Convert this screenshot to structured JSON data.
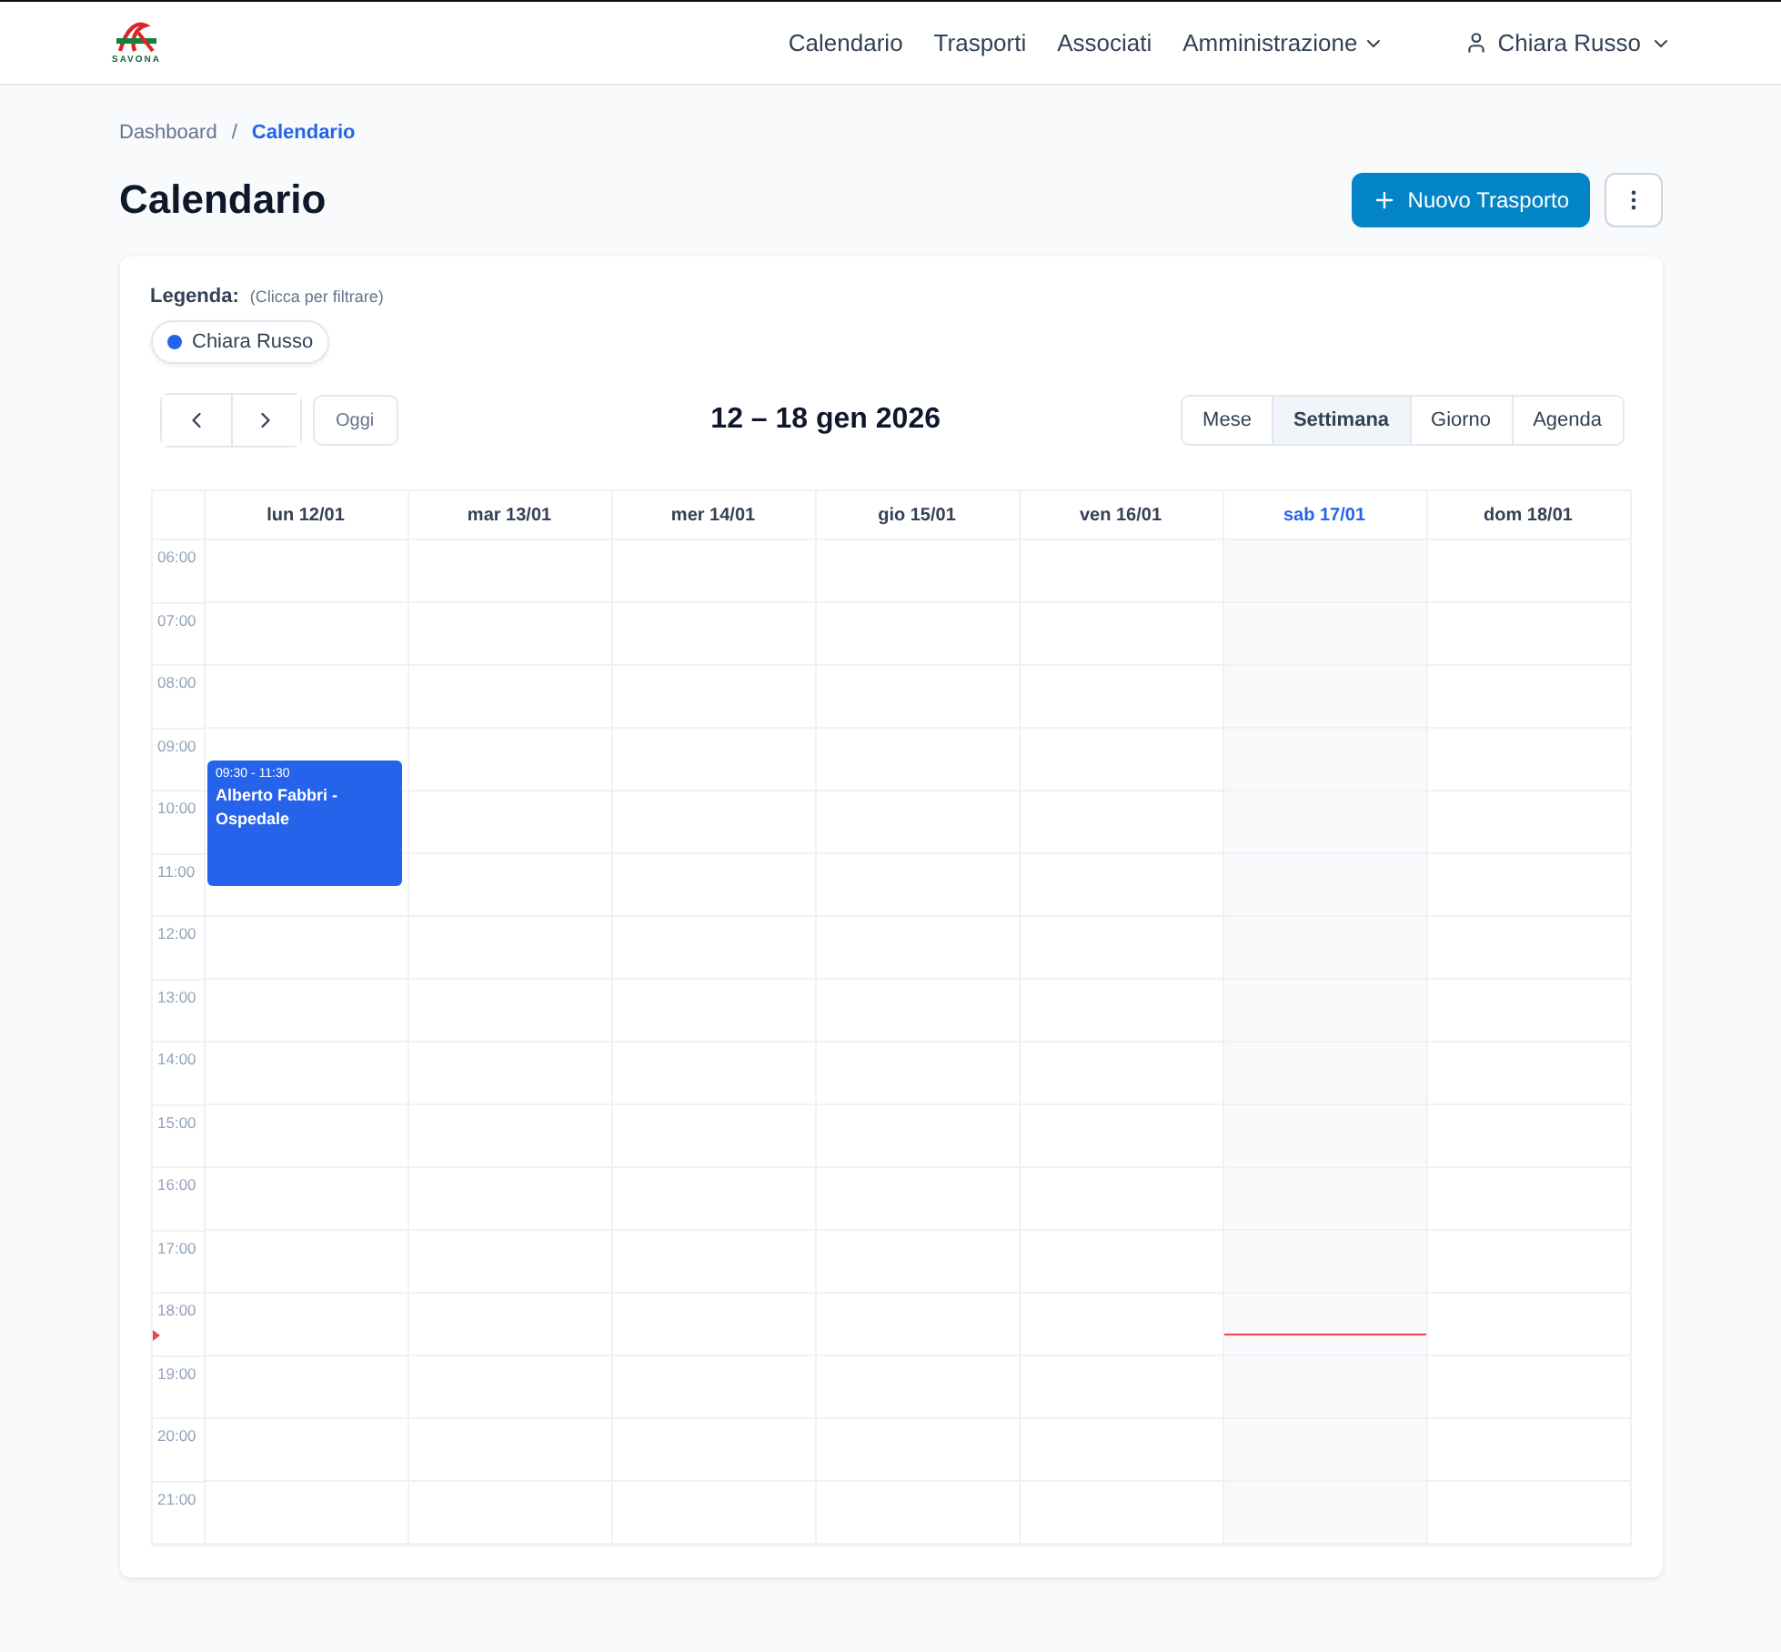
{
  "brand": {
    "text": "SAVONA"
  },
  "nav": [
    {
      "label": "Calendario",
      "dropdown": false
    },
    {
      "label": "Trasporti",
      "dropdown": false
    },
    {
      "label": "Associati",
      "dropdown": false
    },
    {
      "label": "Amministrazione",
      "dropdown": true
    }
  ],
  "user": {
    "name": "Chiara Russo"
  },
  "breadcrumb": [
    {
      "label": "Dashboard",
      "selected": false
    },
    {
      "label": "Calendario",
      "selected": true
    }
  ],
  "breadcrumb_separator": "/",
  "title": "Calendario",
  "new_button": {
    "label": "Nuovo Trasporto"
  },
  "legend": {
    "label": "Legenda:",
    "hint": "(Clicca per filtrare)",
    "items": [
      {
        "name": "Chiara Russo",
        "color": "#2563eb"
      }
    ]
  },
  "toolbar": {
    "today": "Oggi",
    "range": "12 – 18 gen 2026",
    "views": [
      {
        "label": "Mese",
        "selected": false
      },
      {
        "label": "Settimana",
        "selected": true
      },
      {
        "label": "Giorno",
        "selected": false
      },
      {
        "label": "Agenda",
        "selected": false
      }
    ]
  },
  "hours": [
    "06:00",
    "07:00",
    "08:00",
    "09:00",
    "10:00",
    "11:00",
    "12:00",
    "13:00",
    "14:00",
    "15:00",
    "16:00",
    "17:00",
    "18:00",
    "19:00",
    "20:00",
    "21:00"
  ],
  "days": [
    {
      "label": "lun 12/01",
      "today": false,
      "events": [
        {
          "time": "09:30 - 11:30",
          "title": "Alberto Fabbri - Ospedale",
          "color": "#2563eb"
        }
      ]
    },
    {
      "label": "mar 13/01",
      "today": false
    },
    {
      "label": "mer 14/01",
      "today": false
    },
    {
      "label": "gio 15/01",
      "today": false
    },
    {
      "label": "ven 16/01",
      "today": false
    },
    {
      "label": "sab 17/01",
      "today": true
    },
    {
      "label": "dom 18/01",
      "today": false
    }
  ],
  "now_line": {
    "level": 0.792
  }
}
